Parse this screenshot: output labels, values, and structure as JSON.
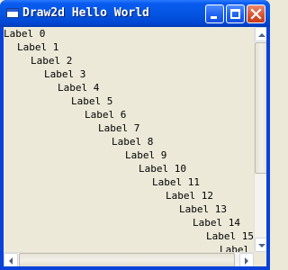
{
  "window": {
    "title": "Draw2d Hello World"
  },
  "labels": [
    "Label 0",
    "Label 1",
    "Label 2",
    "Label 3",
    "Label 4",
    "Label 5",
    "Label 6",
    "Label 7",
    "Label 8",
    "Label 9",
    "Label 10",
    "Label 11",
    "Label 12",
    "Label 13",
    "Label 14",
    "Label 15",
    "Label"
  ],
  "icons": {
    "minimize": "minimize-icon",
    "maximize": "maximize-icon",
    "close": "close-icon",
    "scroll_up": "arrow-up-icon",
    "scroll_down": "arrow-down-icon",
    "scroll_left": "arrow-left-icon",
    "scroll_right": "arrow-right-icon"
  },
  "colors": {
    "titlebar": "#0354e0",
    "client": "#ece9d8",
    "close_button": "#d8502c"
  }
}
